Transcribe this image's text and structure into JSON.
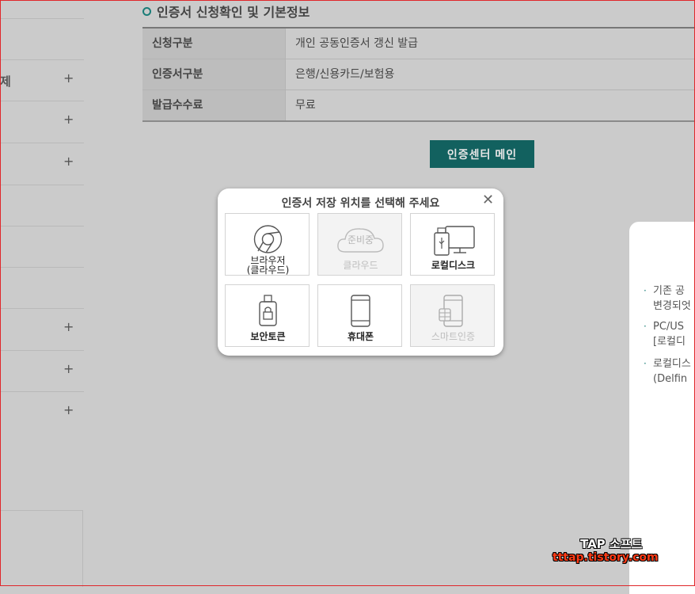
{
  "sidebar": {
    "rows": [
      {
        "text": "",
        "plus": false
      },
      {
        "text": "제",
        "plus": true
      },
      {
        "text": "",
        "plus": true
      },
      {
        "text": "",
        "plus": true
      },
      {
        "text": "",
        "plus": false
      },
      {
        "text": "",
        "plus": false
      },
      {
        "text": "",
        "plus": false
      },
      {
        "text": "",
        "plus": true
      },
      {
        "text": "",
        "plus": true
      },
      {
        "text": "",
        "plus": true
      }
    ],
    "plus_symbol": "+"
  },
  "section": {
    "title": "인증서 신청확인 및 기본정보"
  },
  "info": [
    {
      "label": "신청구분",
      "value": "개인 공동인증서 갱신 발급"
    },
    {
      "label": "인증서구분",
      "value": "은행/신용카드/보험용"
    },
    {
      "label": "발급수수료",
      "value": "무료"
    }
  ],
  "main_button": "인증센터 메인",
  "right_panel": {
    "items": [
      {
        "line1": "기존 공",
        "line2": "변경되엇"
      },
      {
        "line1": "PC/US",
        "line2": "[로컬디"
      },
      {
        "line1": "로컬디스",
        "line2": "(Delfin"
      }
    ]
  },
  "modal": {
    "title": "인증서 저장 위치를 선택해 주세요",
    "close": "✕",
    "options": [
      {
        "label": "브라우저\n(클라우드)",
        "line1": "브라우저",
        "line2": "(클라우드)",
        "icon": "chrome-icon",
        "disabled": false
      },
      {
        "label": "클라우드",
        "line1": "클라우드",
        "line2": "",
        "icon": "cloud-icon",
        "badge": "준비중",
        "disabled": true
      },
      {
        "label": "로컬디스크",
        "line1": "로컬디스크",
        "line2": "",
        "icon": "local-disk-icon",
        "disabled": false
      },
      {
        "label": "보안토큰",
        "line1": "보안토큰",
        "line2": "",
        "icon": "security-token-icon",
        "disabled": false
      },
      {
        "label": "휴대폰",
        "line1": "휴대폰",
        "line2": "",
        "icon": "mobile-phone-icon",
        "disabled": false
      },
      {
        "label": "스마트인증",
        "line1": "스마트인증",
        "line2": "",
        "icon": "smart-auth-icon",
        "disabled": true
      }
    ]
  },
  "watermark": {
    "line1": "TAP 소프트",
    "line2": "tttap.tistory.com"
  },
  "colors": {
    "accent": "#12615f",
    "overlay": "#cbcbcb",
    "frame": "#e0262a"
  }
}
